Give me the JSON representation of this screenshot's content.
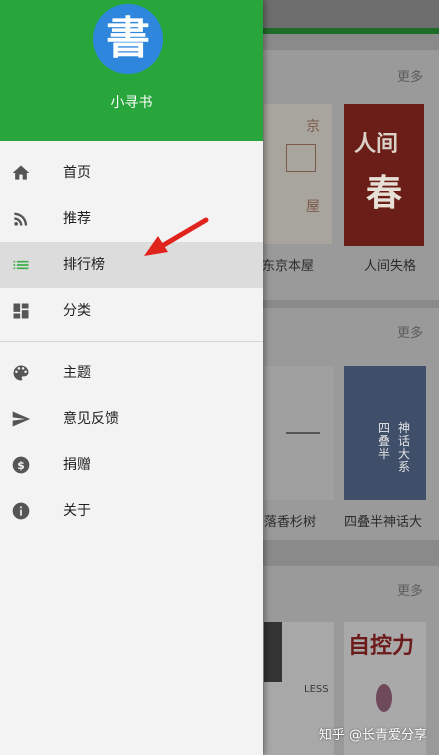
{
  "drawer": {
    "app_name": "小寻书",
    "logo_glyph": "書",
    "items": [
      {
        "label": "首页",
        "icon": "home-icon"
      },
      {
        "label": "推荐",
        "icon": "rss-icon"
      },
      {
        "label": "排行榜",
        "icon": "list-icon",
        "selected": true
      },
      {
        "label": "分类",
        "icon": "dashboard-icon"
      },
      {
        "label": "主题",
        "icon": "palette-icon"
      },
      {
        "label": "意见反馈",
        "icon": "send-icon"
      },
      {
        "label": "捐赠",
        "icon": "dollar-icon"
      },
      {
        "label": "关于",
        "icon": "info-icon"
      }
    ]
  },
  "background": {
    "sections": [
      {
        "more": "更多",
        "books": [
          "东京本屋",
          "人间失格"
        ],
        "cover_text": [
          "京",
          "屋",
          "人间",
          "春"
        ]
      },
      {
        "more": "更多",
        "books": [
          "落香杉树",
          "四叠半神话大"
        ],
        "cover_text": [
          "四叠半",
          "神话大系"
        ]
      },
      {
        "more": "更多",
        "books": [],
        "cover_text": [
          "自控力",
          "LESS"
        ]
      }
    ]
  },
  "watermark": "知乎 @长青爱分享",
  "colors": {
    "header_green": "#28a53b",
    "logo_blue": "#2f87dd",
    "list_icon_green": "#3bae49",
    "arrow_red": "#e0241d",
    "drawer_bg": "#f3f3f3",
    "selected_bg": "#dcdcdc"
  }
}
